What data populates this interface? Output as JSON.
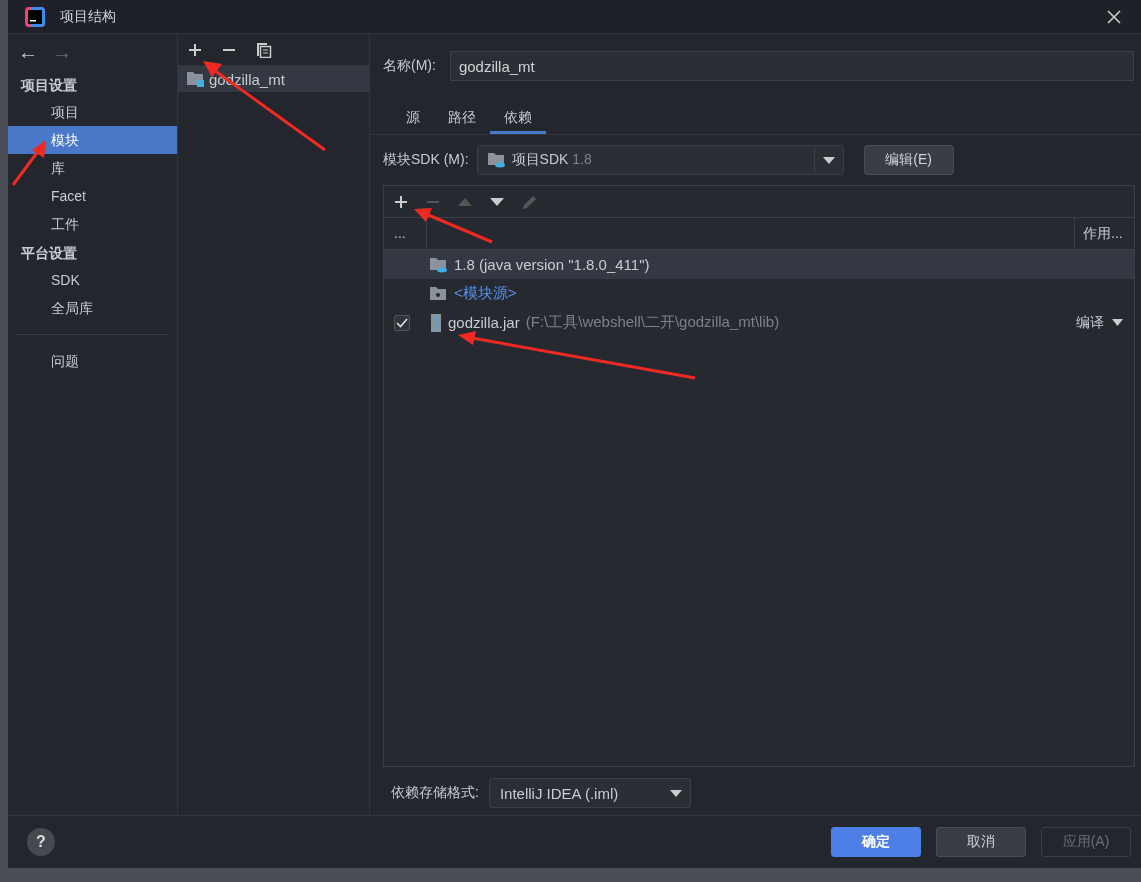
{
  "window": {
    "title": "项目结构"
  },
  "nav": {
    "back": "←",
    "forward": "→"
  },
  "sidebar": {
    "sections": [
      {
        "title": "项目设置",
        "items": [
          {
            "label": "项目",
            "selected": false
          },
          {
            "label": "模块",
            "selected": true
          },
          {
            "label": "库",
            "selected": false
          },
          {
            "label": "Facet",
            "selected": false
          },
          {
            "label": "工件",
            "selected": false
          }
        ]
      },
      {
        "title": "平台设置",
        "items": [
          {
            "label": "SDK",
            "selected": false
          },
          {
            "label": "全局库",
            "selected": false
          }
        ]
      }
    ],
    "problems": "问题"
  },
  "modules": {
    "items": [
      {
        "label": "godzilla_mt",
        "selected": true
      }
    ]
  },
  "name_field": {
    "label": "名称(M):",
    "value": "godzilla_mt"
  },
  "tabs": [
    {
      "label": "源",
      "selected": false
    },
    {
      "label": "路径",
      "selected": false
    },
    {
      "label": "依赖",
      "selected": true
    }
  ],
  "sdk": {
    "label": "模块SDK (M):",
    "value": "项目SDK",
    "version": "1.8",
    "edit_button": "编辑(E)"
  },
  "table": {
    "columns": [
      "...",
      "作用..."
    ],
    "rows": [
      {
        "kind": "sdk",
        "name": "1.8 (java version \"1.8.0_411\")",
        "selected": true
      },
      {
        "kind": "source",
        "name": "<模块源>",
        "selected": false
      },
      {
        "kind": "jar",
        "name": "godzilla.jar",
        "path": "(F:\\工具\\webshell\\二开\\godzilla_mt\\lib)",
        "checked": true,
        "scope": "编译",
        "selected": false
      }
    ]
  },
  "format": {
    "label": "依赖存储格式:",
    "value": "IntelliJ IDEA (.iml)"
  },
  "help": "?",
  "buttons": [
    {
      "label": "确定",
      "kind": "primary",
      "disabled": false
    },
    {
      "label": "取消",
      "kind": "normal",
      "disabled": false
    },
    {
      "label": "应用(A)",
      "kind": "normal",
      "disabled": true
    }
  ]
}
